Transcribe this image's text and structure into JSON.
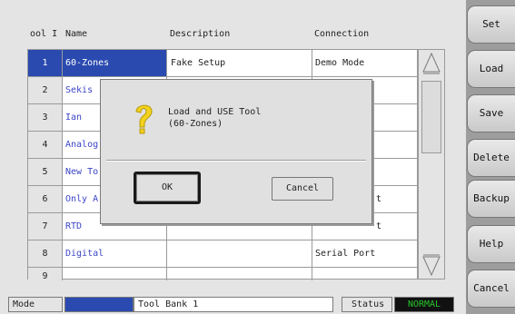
{
  "columns": {
    "tool": "ool I",
    "name": "Name",
    "description": "Description",
    "connection": "Connection"
  },
  "rows": [
    {
      "num": "1",
      "name": "60-Zones",
      "description": "Fake Setup",
      "connection": "Demo Mode"
    },
    {
      "num": "2",
      "name": "Sekis",
      "description": "",
      "connection": ""
    },
    {
      "num": "3",
      "name": "Ian",
      "description": "",
      "connection": ""
    },
    {
      "num": "4",
      "name": "Analog",
      "description": "",
      "connection": ""
    },
    {
      "num": "5",
      "name": "New To",
      "description": "",
      "connection": ""
    },
    {
      "num": "6",
      "name": "Only A",
      "description": "",
      "connection": "t"
    },
    {
      "num": "7",
      "name": "RTD",
      "description": "",
      "connection": "t"
    },
    {
      "num": "8",
      "name": "Digital",
      "description": "",
      "connection": "Serial Port"
    },
    {
      "num": "9",
      "name": "",
      "description": "",
      "connection": ""
    }
  ],
  "selected_row": "1",
  "side_buttons": {
    "set": "Set",
    "load": "Load",
    "save": "Save",
    "delete": "Delete",
    "backup": "Backup",
    "help": "Help",
    "cancel": "Cancel"
  },
  "statusbar": {
    "mode_label": "Mode",
    "bank": "Tool Bank 1",
    "status_label": "Status",
    "status_value": "NORMAL"
  },
  "dialog": {
    "line1": "Load and USE Tool",
    "line2": "(60-Zones)",
    "ok": "OK",
    "cancel": "Cancel",
    "icon": "question-icon"
  },
  "colors": {
    "selection": "#2a4ab0",
    "name_text": "#3c46c8",
    "status_ok": "#27c42a"
  }
}
